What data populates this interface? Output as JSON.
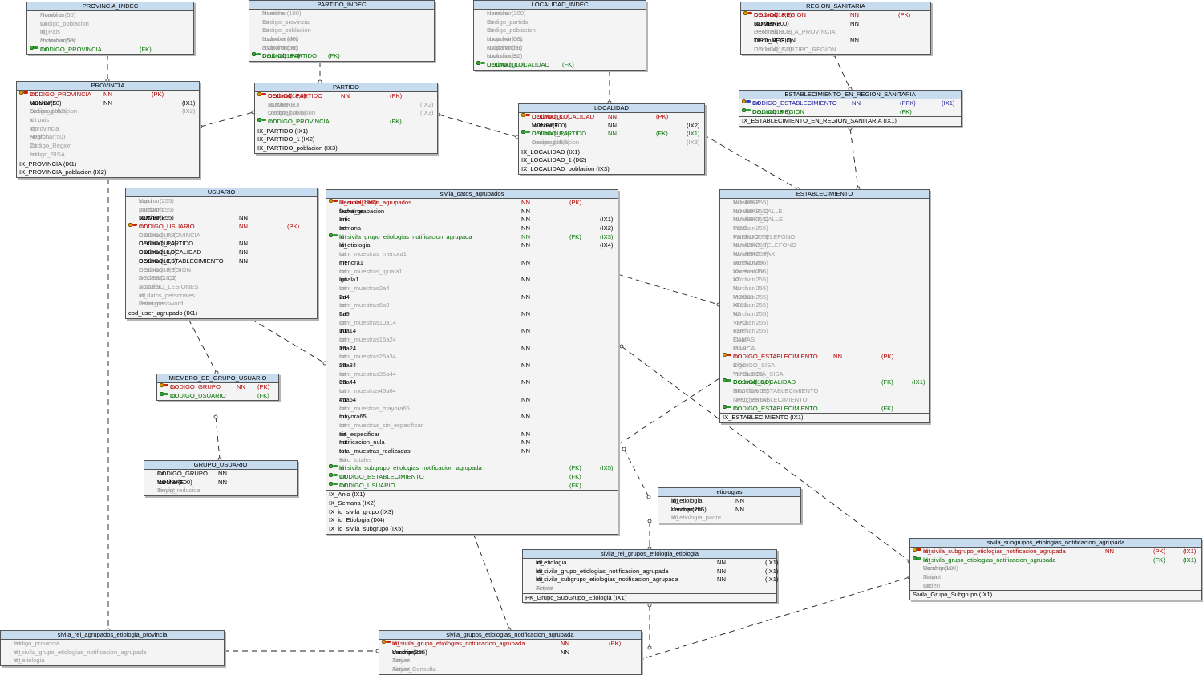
{
  "tables": [
    {
      "id": "provincia_indec",
      "title": "PROVINCIA_INDEC",
      "rows": [
        {
          "name": "Nombre",
          "type": "Nvarchar(50)",
          "opt": true
        },
        {
          "name": "Codigo_poblacion",
          "type": "Int",
          "opt": true
        },
        {
          "name": "id_Pais",
          "type": "Int",
          "opt": true
        },
        {
          "name": "codprovindec",
          "type": "Nvarchar(50)",
          "opt": true
        },
        {
          "name": "CODIGO_PROVINCIA",
          "type": "Int",
          "c1": "",
          "c2": "(FK)",
          "kind": "fk"
        }
      ],
      "indexes": []
    },
    {
      "id": "partido_indec",
      "title": "PARTIDO_INDEC",
      "rows": [
        {
          "name": "Nombre",
          "type": "Nvarchar(100)",
          "opt": true
        },
        {
          "name": "Codigo_provincia",
          "type": "Int",
          "opt": true
        },
        {
          "name": "Codigo_poblacion",
          "type": "Int",
          "opt": true
        },
        {
          "name": "codprovindec",
          "type": "Nvarchar(50)",
          "opt": true
        },
        {
          "name": "codpartindec",
          "type": "Nvarchar(50)",
          "opt": true
        },
        {
          "name": "CODIGO_PARTIDO",
          "type": "Decimal(18,0)",
          "c1": "(FK)",
          "kind": "fk"
        }
      ],
      "indexes": []
    },
    {
      "id": "localidad_indec",
      "title": "LOCALIDAD_INDEC",
      "rows": [
        {
          "name": "Nombre",
          "type": "Nvarchar(200)",
          "opt": true
        },
        {
          "name": "Codigo_partido",
          "type": "Int",
          "opt": true
        },
        {
          "name": "Codigo_poblacion",
          "type": "Int",
          "opt": true
        },
        {
          "name": "codprovindec",
          "type": "Nvarchar(50)",
          "opt": true
        },
        {
          "name": "codpartindec",
          "type": "Nvarchar(50)",
          "opt": true
        },
        {
          "name": "codlocindec",
          "type": "Nvarchar(50)",
          "opt": true
        },
        {
          "name": "CODIGO_LOCALIDAD",
          "type": "Decimal(18,0)",
          "c1": "(FK)",
          "kind": "fk"
        }
      ],
      "indexes": []
    },
    {
      "id": "region_sanitaria",
      "title": "REGION_SANITARIA",
      "rows": [
        {
          "name": "CODIGO_REGION",
          "type": "Decimal(18,0)",
          "c1": "NN",
          "c2": "(PK)",
          "kind": "pk"
        },
        {
          "name": "NOMBRE",
          "type": "Varchar(200)",
          "c1": "NN"
        },
        {
          "name": "PERTENECE_A_PROVINCIA",
          "type": "Decimal(18,0)",
          "opt": true
        },
        {
          "name": "TIPO_REGION",
          "type": "Decimal(18,0)",
          "c1": "NN"
        },
        {
          "name": "CODIGO_SUBTIPO_REGION",
          "type": "Decimal(18,0)",
          "opt": true
        }
      ],
      "indexes": []
    },
    {
      "id": "provincia",
      "title": "PROVINCIA",
      "rows": [
        {
          "name": "CODIGO_PROVINCIA",
          "type": "Int",
          "c1": "NN",
          "c2": "(PK)",
          "kind": "pk"
        },
        {
          "name": "NOMBRE",
          "type": "Varchar(50)",
          "c1": "NN",
          "c3": "(IX1)"
        },
        {
          "name": "codigo_poblacion",
          "type": "Decimal(18,0)",
          "c3": "(IX2)",
          "opt": true
        },
        {
          "name": "id_pais",
          "type": "Int",
          "opt": true
        },
        {
          "name": "idprovincia",
          "type": "Int",
          "opt": true
        },
        {
          "name": "Region",
          "type": "Nvarchar(50)",
          "opt": true
        },
        {
          "name": "Codigo_Region",
          "type": "Int",
          "opt": true
        },
        {
          "name": "codigo_SISA",
          "type": "Int",
          "opt": true
        }
      ],
      "indexes": [
        "IX_PROVINCIA (IX1)",
        "IX_PROVINCIA_poblacion (IX2)"
      ]
    },
    {
      "id": "partido",
      "title": "PARTIDO",
      "rows": [
        {
          "name": "CODIGO_PARTIDO",
          "type": "Decimal(18,0)",
          "c1": "NN",
          "c2": "(PK)",
          "kind": "pk"
        },
        {
          "name": "NOMBRE",
          "type": "Varchar(50)",
          "c3": "(IX2)",
          "opt": true
        },
        {
          "name": "codigo_poblacion",
          "type": "Decimal(18,0)",
          "c3": "(IX3)",
          "opt": true
        },
        {
          "name": "CODIGO_PROVINCIA",
          "type": "Int",
          "c2": "(FK)",
          "kind": "fk"
        }
      ],
      "indexes": [
        "IX_PARTIDO (IX1)",
        "IX_PARTIDO_1 (IX2)",
        "IX_PARTIDO_poblacion (IX3)"
      ]
    },
    {
      "id": "localidad",
      "title": "LOCALIDAD",
      "rows": [
        {
          "name": "CODIGO_LOCALIDAD",
          "type": "Decimal(18,0)",
          "c1": "NN",
          "c2": "(PK)",
          "kind": "pk"
        },
        {
          "name": "NOMBRE",
          "type": "Varchar(100)",
          "c1": "NN",
          "c3": "(IX2)"
        },
        {
          "name": "CODIGO_PARTIDO",
          "type": "Decimal(18,0)",
          "c1": "NN",
          "c2": "(FK)",
          "c3": "(IX1)",
          "kind": "fk"
        },
        {
          "name": "codigo_poblacion",
          "type": "Decimal(18,0)",
          "c3": "(IX3)",
          "opt": true
        }
      ],
      "indexes": [
        "IX_LOCALIDAD (IX1)",
        "IX_LOCALIDAD_1 (IX2)",
        "IX_LOCALIDAD_poblacion (IX3)"
      ]
    },
    {
      "id": "est_en_region",
      "title": "ESTABLECIMIENTO_EN_REGION_SANITARIA",
      "rows": [
        {
          "name": "CODIGO_ESTABLECIMIENTO",
          "type": "Int",
          "c1": "NN",
          "c2": "(PFK)",
          "c3": "(IX1)",
          "kind": "pfk"
        },
        {
          "name": "CODIGO_REGION",
          "type": "Decimal(18,0)",
          "c2": "(FK)",
          "kind": "fk"
        }
      ],
      "indexes": [
        "IX_ESTABLECIMIENTO_EN_REGION_SANITARIA (IX1)"
      ]
    },
    {
      "id": "usuario",
      "title": "USUARIO",
      "rows": [
        {
          "name": "login",
          "type": "Varchar(255)",
          "opt": true
        },
        {
          "name": "password",
          "type": "Varchar(255)",
          "opt": true
        },
        {
          "name": "NOMBRE",
          "type": "Varchar(255)",
          "c1": "NN"
        },
        {
          "name": "CODIGO_USUARIO",
          "type": "Int",
          "c1": "NN",
          "c2": "(PK)",
          "kind": "pk"
        },
        {
          "name": "CODIGO_PROVINCIA",
          "type": "Decimal(18,0)",
          "opt": true
        },
        {
          "name": "CODIGO_PARTIDO",
          "type": "Decimal(18,0)",
          "c1": "NN"
        },
        {
          "name": "CODIGO_LOCALIDAD",
          "type": "Decimal(18,0)",
          "c1": "NN"
        },
        {
          "name": "CODIGO_ESTABLECIMIENTO",
          "type": "Decimal(18,0)",
          "c1": "NN"
        },
        {
          "name": "CODIGO_REGION",
          "type": "Decimal(18,0)",
          "opt": true
        },
        {
          "name": "ACCESO_C2",
          "type": "Decimal(18,0)",
          "opt": true
        },
        {
          "name": "ACCESO_LESIONES",
          "type": "Smallint",
          "opt": true
        },
        {
          "name": "id_datos_personales",
          "type": "Int",
          "opt": true
        },
        {
          "name": "fecha_password",
          "type": "Datetime",
          "opt": true
        }
      ],
      "indexes": [
        "cod_user_agrupado (IX1)"
      ]
    },
    {
      "id": "sivila_datos_agrupados",
      "title": "sivila_datos_agrupados",
      "rows": [
        {
          "name": "id_sivila_datos_agrupados",
          "type": "Decimal(18,0)",
          "c1": "NN",
          "c2": "(PK)",
          "kind": "pk"
        },
        {
          "name": "fecha_grabacion",
          "type": "Datetime",
          "c1": "NN"
        },
        {
          "name": "anio",
          "type": "Int",
          "c1": "NN",
          "c3": "(IX1)"
        },
        {
          "name": "semana",
          "type": "Int",
          "c1": "NN",
          "c3": "(IX2)"
        },
        {
          "name": "id_sivila_grupo_etiologias_notificacion_agrupada",
          "type": "Int",
          "c1": "NN",
          "c2": "(FK)",
          "c3": "(IX3)",
          "kind": "fk"
        },
        {
          "name": "id_etiologia",
          "type": "Int",
          "c1": "NN",
          "c3": "(IX4)"
        },
        {
          "name": "cant_muestras_menora1",
          "type": "Int",
          "opt": true
        },
        {
          "name": "menora1",
          "type": "Int",
          "c1": "NN"
        },
        {
          "name": "cant_muestras_iguala1",
          "type": "Int",
          "opt": true
        },
        {
          "name": "iguala1",
          "type": "Int",
          "c1": "NN"
        },
        {
          "name": "cant_muestras2a4",
          "type": "Int",
          "opt": true
        },
        {
          "name": "2a4",
          "type": "Int",
          "c1": "NN"
        },
        {
          "name": "cant_muestras5a9",
          "type": "Int",
          "opt": true
        },
        {
          "name": "5a9",
          "type": "Int",
          "c1": "NN"
        },
        {
          "name": "cant_muestras10a14",
          "type": "Int",
          "opt": true
        },
        {
          "name": "10a14",
          "type": "Int",
          "c1": "NN"
        },
        {
          "name": "cant_muestras15a24",
          "type": "Int",
          "opt": true
        },
        {
          "name": "15a24",
          "type": "Int",
          "c1": "NN"
        },
        {
          "name": "cant_muestras25a34",
          "type": "Int",
          "opt": true
        },
        {
          "name": "25a34",
          "type": "Int",
          "c1": "NN"
        },
        {
          "name": "cant_muestras35a44",
          "type": "Int",
          "opt": true
        },
        {
          "name": "35a44",
          "type": "Int",
          "c1": "NN"
        },
        {
          "name": "cant_muestras45a64",
          "type": "Int",
          "opt": true
        },
        {
          "name": "45a64",
          "type": "Int",
          "c1": "NN"
        },
        {
          "name": "cant_muestras_mayora65",
          "type": "Int",
          "opt": true
        },
        {
          "name": "mayora65",
          "type": "Int",
          "c1": "NN"
        },
        {
          "name": "cant_muestras_sin_especificar",
          "type": "Int",
          "opt": true
        },
        {
          "name": "sin_especificar",
          "type": "Int",
          "c1": "NN"
        },
        {
          "name": "notificacion_nula",
          "type": "Int",
          "c1": "NN"
        },
        {
          "name": "total_muestras_realizadas",
          "type": "Int",
          "c1": "NN"
        },
        {
          "name": "solo_totales",
          "type": "Bit",
          "opt": true
        },
        {
          "name": "id_sivila_subgrupo_etiologias_notificacion_agrupada",
          "type": "Int",
          "c2": "(FK)",
          "c3": "(IX5)",
          "kind": "fk"
        },
        {
          "name": "CODIGO_ESTABLECIMIENTO",
          "type": "Int",
          "c2": "(FK)",
          "kind": "fk"
        },
        {
          "name": "CODIGO_USUARIO",
          "type": "Int",
          "c2": "(FK)",
          "kind": "fk"
        }
      ],
      "indexes": [
        "IX_Anio (IX1)",
        "IX_Semana (IX2)",
        "IX_id_sivila_grupo (IX3)",
        "IX_id_Etiologia (IX4)",
        "IX_id_sivila_subgrupo (IX5)"
      ]
    },
    {
      "id": "establecimiento",
      "title": "ESTABLECIMIENTO",
      "rows": [
        {
          "name": "NOMBRE",
          "type": "Varchar(255)",
          "opt": true
        },
        {
          "name": "NOMBRE_CALLE",
          "type": "Varchar(255)",
          "opt": true
        },
        {
          "name": "NUMERO_CALLE",
          "type": "Varchar(255)",
          "opt": true
        },
        {
          "name": "PISO",
          "type": "Varchar(255)",
          "opt": true
        },
        {
          "name": "PREFIJO_TELEFONO",
          "type": "Varchar(255)",
          "opt": true
        },
        {
          "name": "NUMERO_TELEFONO",
          "type": "Varchar(255)",
          "opt": true
        },
        {
          "name": "NUMERO_FAX",
          "type": "Varchar(255)",
          "opt": true
        },
        {
          "name": "DEPADMIN",
          "type": "Varchar(255)",
          "opt": true
        },
        {
          "name": "Abreviatura",
          "type": "Varchar(255)",
          "opt": true
        },
        {
          "name": "AT",
          "type": "Varchar(255)",
          "opt": true
        },
        {
          "name": "N1",
          "type": "Varchar(255)",
          "opt": true
        },
        {
          "name": "MOD01",
          "type": "Varchar(255)",
          "opt": true
        },
        {
          "name": "AT01",
          "type": "Varchar(255)",
          "opt": true
        },
        {
          "name": "N2",
          "type": "Varchar(255)",
          "opt": true
        },
        {
          "name": "TIPO",
          "type": "Varchar(255)",
          "opt": true
        },
        {
          "name": "ESP",
          "type": "Varchar(255)",
          "opt": true
        },
        {
          "name": "CAMAS",
          "type": "Float",
          "opt": true
        },
        {
          "name": "MARCA",
          "type": "Float",
          "opt": true
        },
        {
          "name": "CODIGO_ESTABLECIMIENTO",
          "type": "Int",
          "c1": "NN",
          "c2": "(PK)",
          "kind": "pk"
        },
        {
          "name": "CODIGO_SISA",
          "type": "Bigint",
          "opt": true
        },
        {
          "name": "TIPOLOGIA_SISA",
          "type": "Varchar(15)",
          "opt": true
        },
        {
          "name": "CODIGO_LOCALIDAD",
          "type": "Decimal(18,0)",
          "c2": "(FK)",
          "c3": "(IX1)",
          "kind": "fk"
        },
        {
          "name": "SECTOR_ESTABLECIMIENTO",
          "type": "Nvarchar(50)",
          "opt": true
        },
        {
          "name": "TIPO_ESTABLECIMIENTO",
          "type": "Nvarchar(50)",
          "opt": true
        },
        {
          "name": "CODIGO_ESTABLECIMIENTO",
          "type": "Int",
          "c2": "(FK)",
          "kind": "fk"
        }
      ],
      "indexes": [
        "IX_ESTABLECIMIENTO (IX1)"
      ]
    },
    {
      "id": "miembro_grupo",
      "title": "MIEMBRO_DE_GRUPO_USUARIO",
      "rows": [
        {
          "name": "CODIGO_GRUPO",
          "type": "Int",
          "c1": "NN",
          "c2": "(PK)",
          "kind": "pk"
        },
        {
          "name": "CODIGO_USUARIO",
          "type": "Int",
          "c2": "(FK)",
          "kind": "fk"
        }
      ],
      "indexes": []
    },
    {
      "id": "grupo_usuario",
      "title": "GRUPO_USUARIO",
      "rows": [
        {
          "name": "CODIGO_GRUPO",
          "type": "Int",
          "c1": "NN"
        },
        {
          "name": "NOMBRE",
          "type": "Varchar(100)",
          "c1": "NN"
        },
        {
          "name": "config_reducida",
          "type": "Tinyint",
          "opt": true
        }
      ],
      "indexes": []
    },
    {
      "id": "etiologias",
      "title": "etiologias",
      "rows": [
        {
          "name": "id_etiologia",
          "type": "Int",
          "c1": "NN"
        },
        {
          "name": "descripcion",
          "type": "Varchar(255)",
          "c1": "NN"
        },
        {
          "name": "id_etiologia_padre",
          "type": "Int",
          "opt": true
        }
      ],
      "indexes": []
    },
    {
      "id": "subgrupos",
      "title": "sivila_subgrupos_etiologias_notificacion_agrupada",
      "rows": [
        {
          "name": "id_sivila_subgrupo_etiologias_notificacion_agrupada",
          "type": "Int",
          "c1": "NN",
          "c2": "(PK)",
          "c3": "(IX1)",
          "kind": "pk"
        },
        {
          "name": "id_sivila_grupo_etiologias_notificacion_agrupada",
          "type": "Int",
          "c2": "(FK)",
          "c3": "(IX1)",
          "kind": "fk"
        },
        {
          "name": "Descripcion",
          "type": "Varchar(100)",
          "opt": true
        },
        {
          "name": "activo",
          "type": "Tinyint",
          "opt": true
        },
        {
          "name": "Orden",
          "type": "Int",
          "opt": true
        }
      ],
      "indexes": [
        "Sivila_Grupo_Subgrupo (IX1)"
      ]
    },
    {
      "id": "rel_grupos",
      "title": "sivila_rel_grupos_etiologia_etiologia",
      "rows": [
        {
          "name": "id_etiologia",
          "type": "Int",
          "c1": "NN",
          "c3": "(IX1)"
        },
        {
          "name": "id_sivila_grupo_etiologias_notificacion_agrupada",
          "type": "Int",
          "c1": "NN",
          "c3": "(IX1)"
        },
        {
          "name": "id_sivila_subgrupo_etiologias_notificacion_agrupada",
          "type": "Int",
          "c1": "NN",
          "c3": "(IX1)"
        },
        {
          "name": "Activo",
          "type": "Tinyint",
          "opt": true
        }
      ],
      "indexes": [
        "PK_Grupo_SubGrupo_Etiologia (IX1)"
      ]
    },
    {
      "id": "rel_agrupados",
      "title": "sivila_rel_agrupados_etiologia_provincia",
      "rows": [
        {
          "name": "codigo_provincia",
          "type": "Int",
          "opt": true
        },
        {
          "name": "id_sivila_grupo_etiologias_notificacion_agrupada",
          "type": "Int",
          "opt": true
        },
        {
          "name": "id_etiologia",
          "type": "Int",
          "opt": true
        }
      ],
      "indexes": []
    },
    {
      "id": "grupos",
      "title": "sivila_grupos_etiologias_notificacion_agrupada",
      "rows": [
        {
          "name": "id_sivila_grupo_etiologias_notificacion_agrupada",
          "type": "Int",
          "c1": "NN",
          "c2": "(PK)",
          "kind": "pk"
        },
        {
          "name": "descripcion",
          "type": "Varchar(255)",
          "c1": "NN"
        },
        {
          "name": "Activo",
          "type": "Tinyint",
          "opt": true
        },
        {
          "name": "Activo_Consulta",
          "type": "Tinyint",
          "opt": true
        }
      ],
      "indexes": []
    }
  ]
}
